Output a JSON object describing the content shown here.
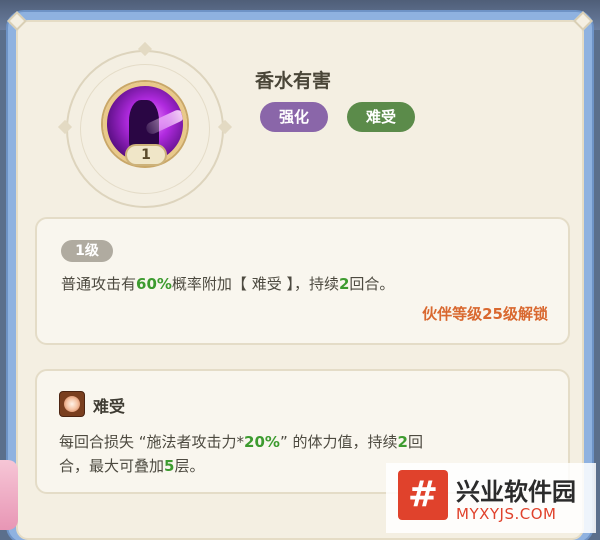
{
  "skill": {
    "name": "香水有害",
    "level": "1",
    "tags": [
      "强化",
      "难受"
    ]
  },
  "grade_card": {
    "grade": "1级",
    "desc_parts": [
      "普通攻击有",
      "60%",
      "概率附加【 难受 】，持续",
      "2",
      "回合。"
    ],
    "unlock": "伙伴等级25级解锁"
  },
  "effect_card": {
    "icon": "swirl-debuff-icon",
    "name": "难受",
    "line1_parts": [
      "每回合损失 “施法者攻击力*",
      "20%",
      "” 的体力值，持续",
      "2",
      "回"
    ],
    "line2_parts": [
      "合，最大可叠加",
      "5",
      "层。"
    ]
  },
  "watermark": {
    "logo_text": "#",
    "title": "兴业软件园",
    "url": "MYXYJS.COM"
  },
  "colors": {
    "panel": "#f4efe2",
    "highlight": "#3d9b2f",
    "unlock": "#d9682f",
    "tag_strengthen": "#8a66a9",
    "tag_suffer": "#5b8b4a"
  }
}
